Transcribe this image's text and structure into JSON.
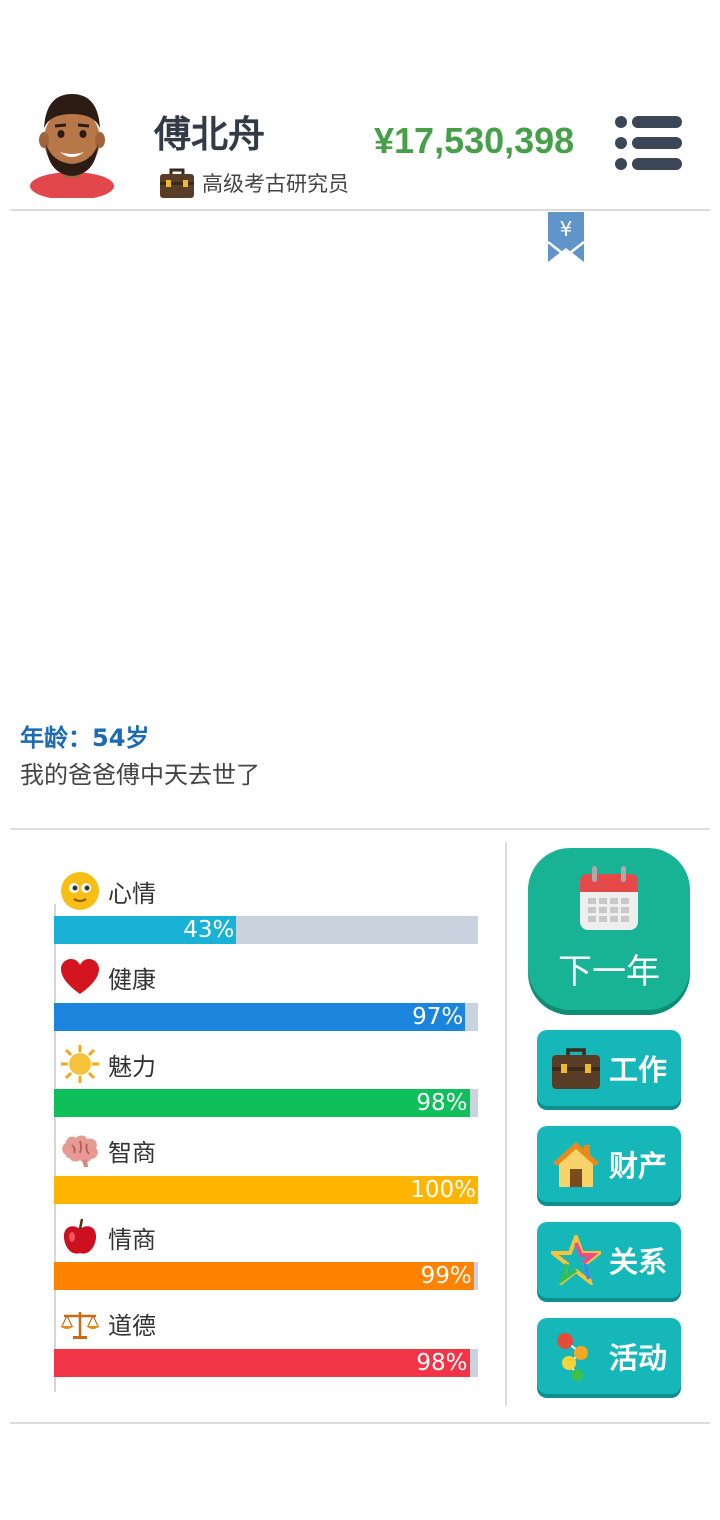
{
  "player": {
    "name": "傅北舟",
    "job": "高级考古研究员",
    "money": "¥17,530,398"
  },
  "icons": {
    "avatar": "bearded-man-avatar",
    "job": "briefcase-icon",
    "menu": "menu-list-icon",
    "bookmark": "yuan-bookmark-icon"
  },
  "bookmark": {
    "symbol": "¥"
  },
  "log": {
    "age_line": "年龄：54岁",
    "event": "我的爸爸傅中天去世了"
  },
  "stats": [
    {
      "label": "心情",
      "value": 43,
      "pct": "43%",
      "color": "#19b1d6",
      "icon": "smiley-face-icon"
    },
    {
      "label": "健康",
      "value": 97,
      "pct": "97%",
      "color": "#1b84dd",
      "icon": "heart-icon"
    },
    {
      "label": "魅力",
      "value": 98,
      "pct": "98%",
      "color": "#0fbf5a",
      "icon": "sun-icon"
    },
    {
      "label": "智商",
      "value": 100,
      "pct": "100%",
      "color": "#ffb400",
      "icon": "brain-icon"
    },
    {
      "label": "情商",
      "value": 99,
      "pct": "99%",
      "color": "#ff8200",
      "icon": "apple-icon"
    },
    {
      "label": "道德",
      "value": 98,
      "pct": "98%",
      "color": "#f23546",
      "icon": "scales-icon"
    }
  ],
  "actions": {
    "next_year": "下一年",
    "work": "工作",
    "property": "财产",
    "relations": "关系",
    "activities": "活动"
  },
  "colors": {
    "money": "#46a04a",
    "age": "#1b6ab3",
    "next_year_bg": "#17b394",
    "action_bg": "#15b7b9"
  }
}
